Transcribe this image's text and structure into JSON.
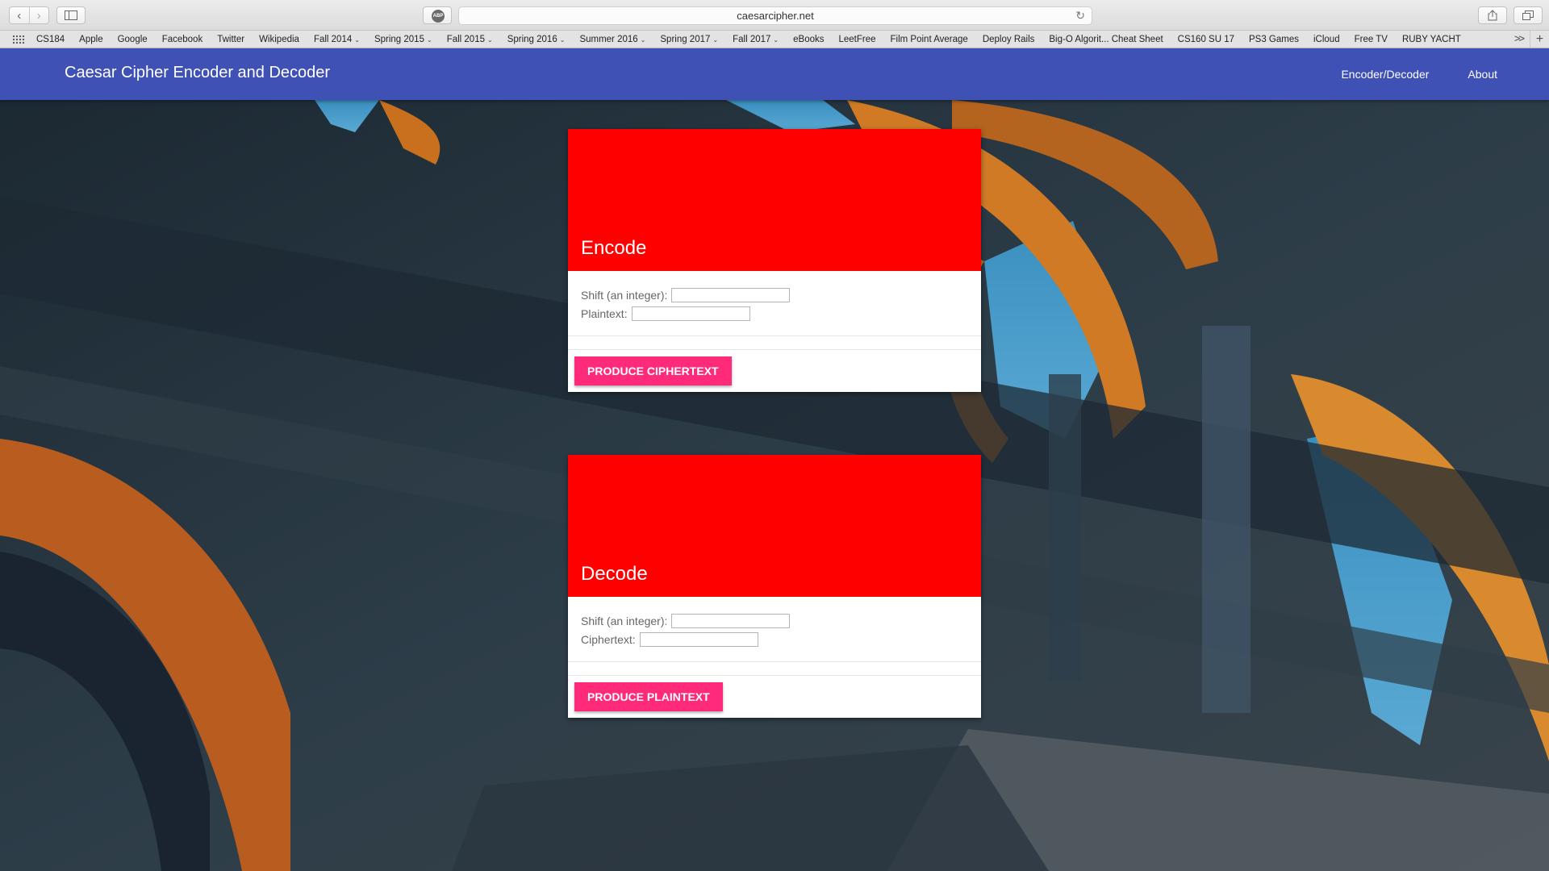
{
  "browser": {
    "url": "caesarcipher.net",
    "abp_label": "ABP",
    "back_glyph": "‹",
    "forward_glyph": "›",
    "reload_glyph": "↻",
    "more_glyph": ">>",
    "add_glyph": "+",
    "bookmarks": [
      {
        "label": "CS184",
        "folder": false
      },
      {
        "label": "Apple",
        "folder": false
      },
      {
        "label": "Google",
        "folder": false
      },
      {
        "label": "Facebook",
        "folder": false
      },
      {
        "label": "Twitter",
        "folder": false
      },
      {
        "label": "Wikipedia",
        "folder": false
      },
      {
        "label": "Fall 2014",
        "folder": true
      },
      {
        "label": "Spring 2015",
        "folder": true
      },
      {
        "label": "Fall 2015",
        "folder": true
      },
      {
        "label": "Spring 2016",
        "folder": true
      },
      {
        "label": "Summer 2016",
        "folder": true
      },
      {
        "label": "Spring 2017",
        "folder": true
      },
      {
        "label": "Fall 2017",
        "folder": true
      },
      {
        "label": "eBooks",
        "folder": false
      },
      {
        "label": "LeetFree",
        "folder": false
      },
      {
        "label": "Film Point Average",
        "folder": false
      },
      {
        "label": "Deploy Rails",
        "folder": false
      },
      {
        "label": "Big-O Algorit... Cheat Sheet",
        "folder": false
      },
      {
        "label": "CS160 SU 17",
        "folder": false
      },
      {
        "label": "PS3 Games",
        "folder": false
      },
      {
        "label": "iCloud",
        "folder": false
      },
      {
        "label": "Free TV",
        "folder": false
      },
      {
        "label": "RUBY YACHT",
        "folder": false
      }
    ]
  },
  "appbar": {
    "title": "Caesar Cipher Encoder and Decoder",
    "nav": [
      "Encoder/Decoder",
      "About"
    ]
  },
  "encode": {
    "title": "Encode",
    "shift_label": "Shift (an integer):",
    "shift_value": "",
    "text_label": "Plaintext:",
    "text_value": "",
    "button": "Produce Ciphertext"
  },
  "decode": {
    "title": "Decode",
    "shift_label": "Shift (an integer):",
    "shift_value": "",
    "text_label": "Ciphertext:",
    "text_value": "",
    "button": "Produce Plaintext"
  },
  "colors": {
    "appbar": "#3f51b5",
    "card_header": "#ff0000",
    "button": "#ff2a7a"
  }
}
